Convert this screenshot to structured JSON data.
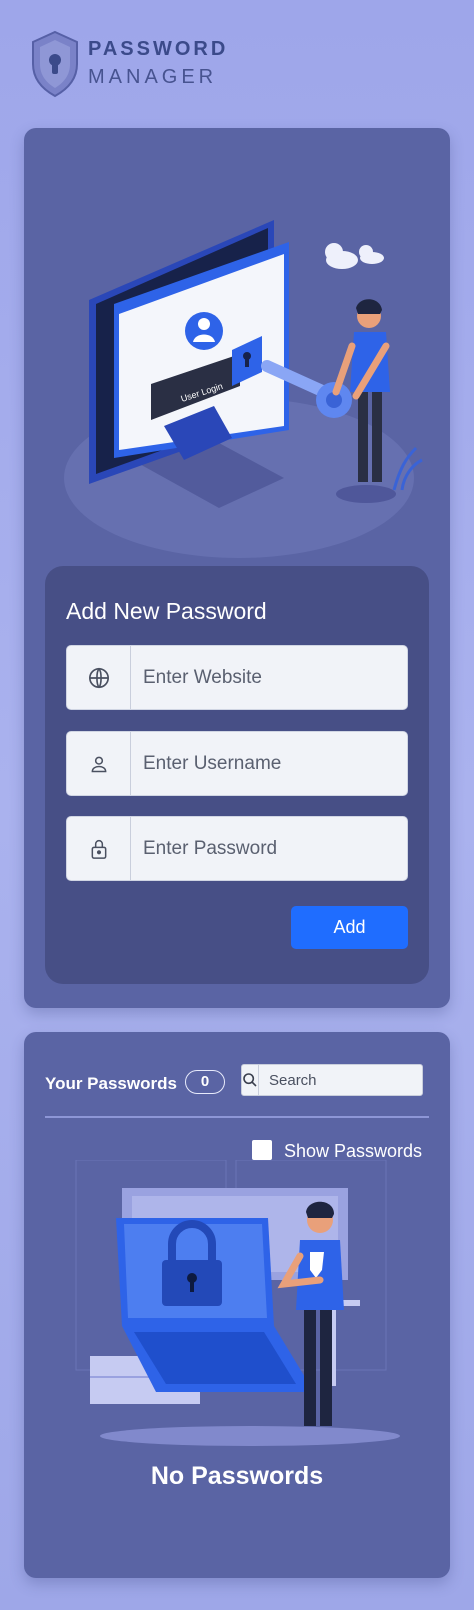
{
  "app": {
    "brand_line1": "PASSWORD",
    "brand_line2": "MANAGER",
    "logo_icon": "shield-keyhole-icon",
    "accent": "#1f6dff"
  },
  "hero": {
    "login_label": "User Login"
  },
  "form": {
    "title": "Add New Password",
    "website": {
      "placeholder": "Enter Website",
      "icon": "globe-icon"
    },
    "username": {
      "placeholder": "Enter Username",
      "icon": "user-icon"
    },
    "password": {
      "placeholder": "Enter Password",
      "icon": "lock-icon"
    },
    "add_label": "Add"
  },
  "list": {
    "title": "Your Passwords",
    "count": "0",
    "search_placeholder": "Search",
    "show_passwords_label": "Show Passwords",
    "show_passwords_checked": false,
    "empty_text": "No Passwords"
  }
}
